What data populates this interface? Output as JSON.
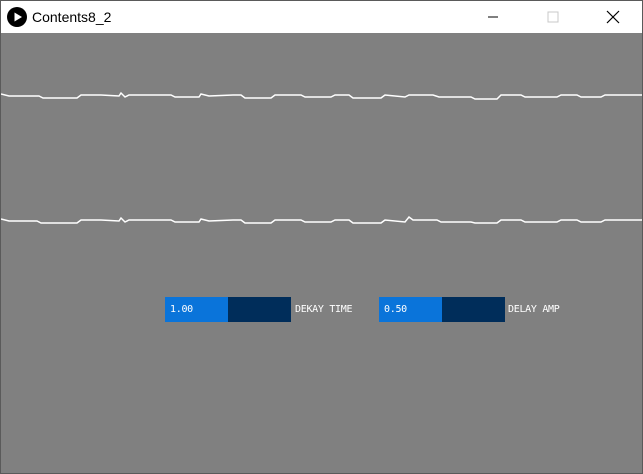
{
  "window": {
    "title": "Contents8_2",
    "minimize_icon": "minimize-icon",
    "maximize_icon": "maximize-icon",
    "close_icon": "close-icon",
    "app_icon": "play-icon"
  },
  "colors": {
    "canvas_bg": "#808080",
    "wave": "#ffffff",
    "slider_fill": "#0a74da",
    "slider_track": "#002d5a",
    "label_text": "#ffffff"
  },
  "controls": {
    "decay_time": {
      "value_text": "1.00",
      "label": "DEKAY TIME",
      "fill_fraction": 0.5
    },
    "delay_amp": {
      "value_text": "0.50",
      "label": "DELAY AMP",
      "fill_fraction": 0.5
    }
  }
}
